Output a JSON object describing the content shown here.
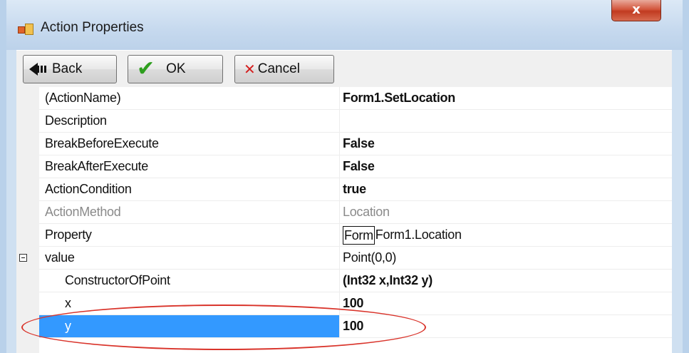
{
  "window": {
    "title": "Action Properties",
    "app_icon": "form-properties-icon",
    "close_label": "x"
  },
  "toolbar": {
    "back_label": "Back",
    "ok_label": "OK",
    "cancel_label": "Cancel",
    "icons": {
      "back": "back-arrow-icon",
      "ok": "checkmark-icon",
      "cancel": "red-x-icon"
    }
  },
  "grid": {
    "rows": [
      {
        "name": "(ActionName)",
        "value": "Form1.SetLocation"
      },
      {
        "name": "Description",
        "value": ""
      },
      {
        "name": "BreakBeforeExecute",
        "value": "False"
      },
      {
        "name": "BreakAfterExecute",
        "value": "False"
      },
      {
        "name": "ActionCondition",
        "value": "true"
      },
      {
        "name": "ActionMethod",
        "value": "Location"
      },
      {
        "name": "Property",
        "value_editing": "Form",
        "value": "Form1.Location"
      },
      {
        "name": "value",
        "value": "Point(0,0)"
      },
      {
        "name": "ConstructorOfPoint",
        "value": "(Int32 x,Int32 y)"
      },
      {
        "name": "x",
        "value": "100"
      },
      {
        "name": "y",
        "value": "100"
      }
    ]
  },
  "colors": {
    "selection": "#3399ff",
    "annotation_ellipse": "#d9342b",
    "ok_check": "#2e9e1e",
    "cancel_x": "#d41e1e"
  }
}
